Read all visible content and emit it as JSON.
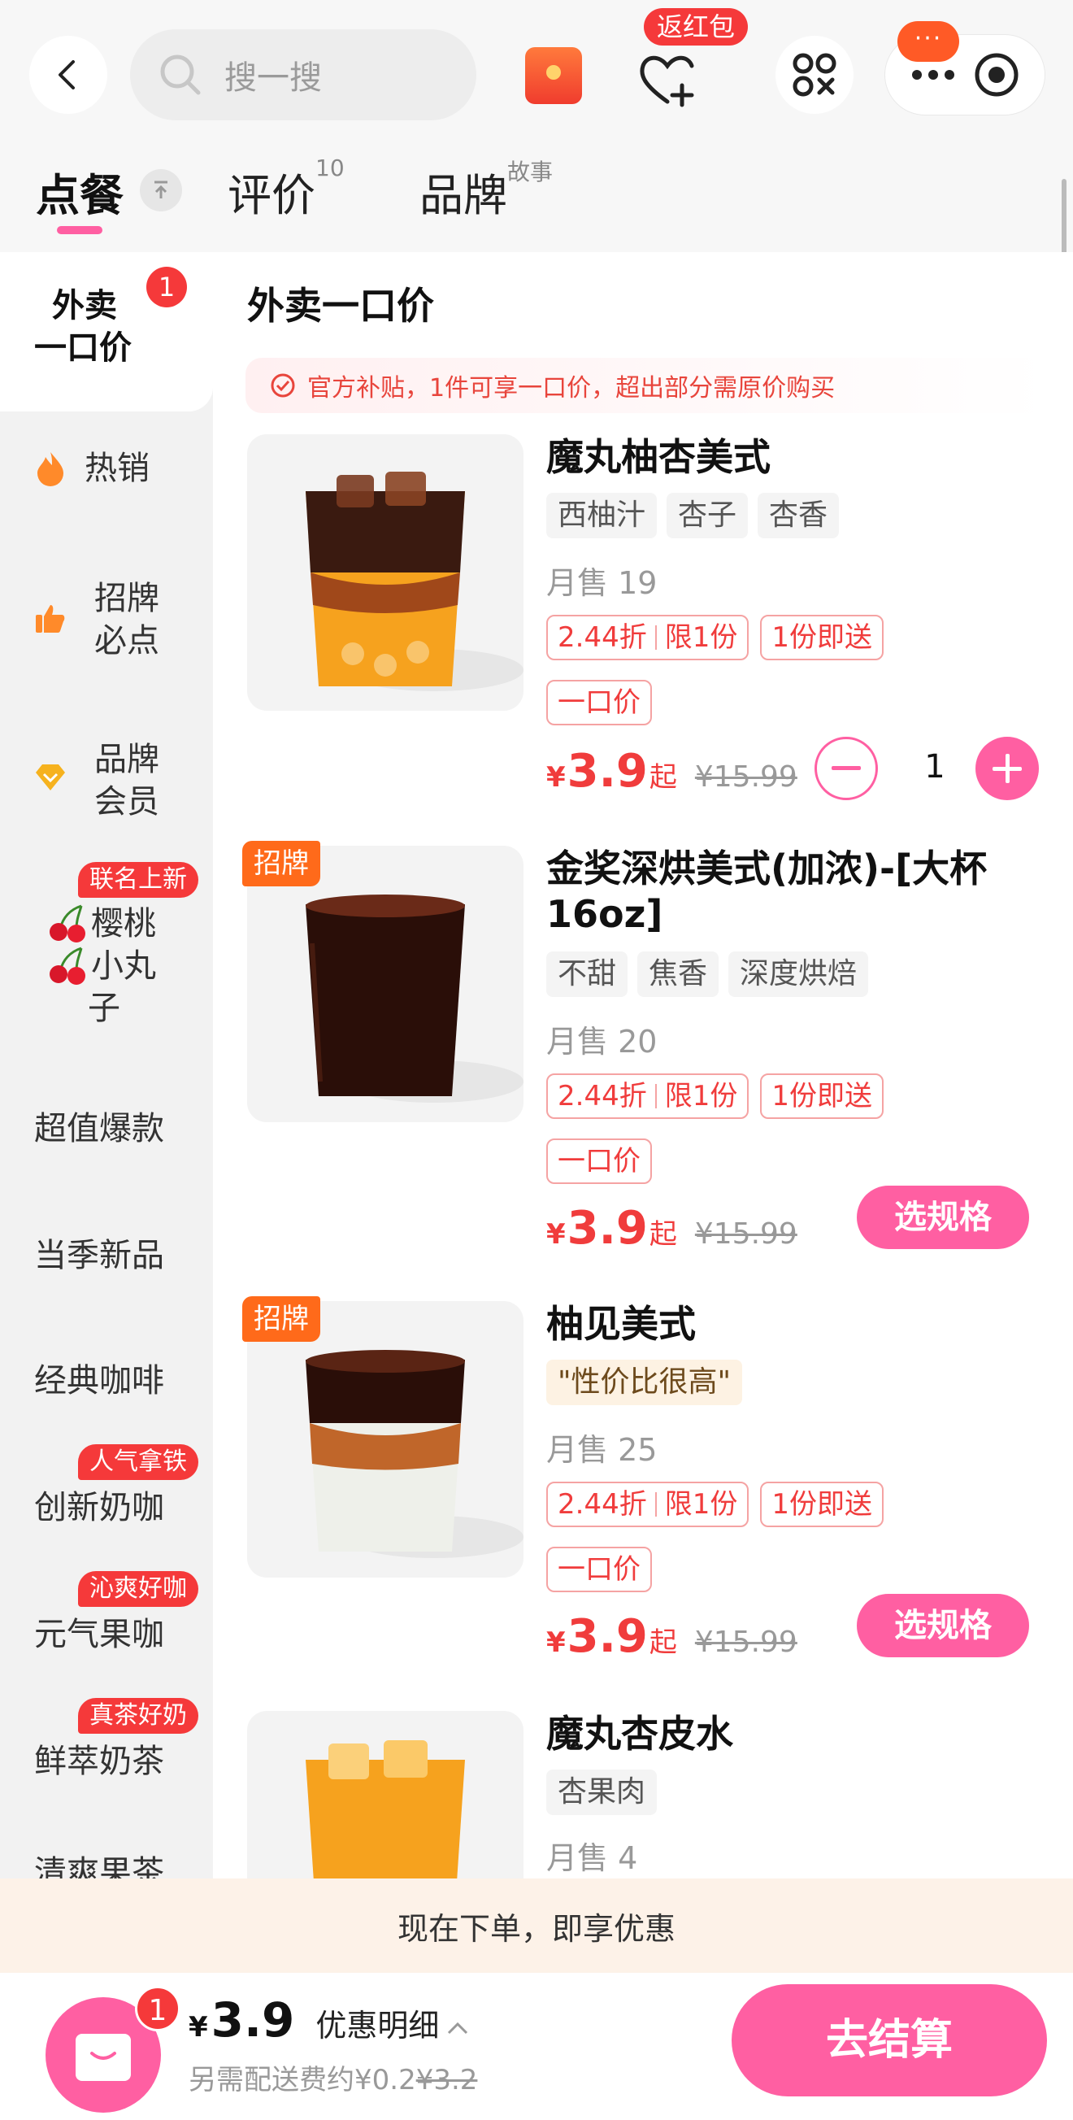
{
  "header": {
    "search_placeholder": "搜一搜",
    "fanhongbao_badge": "返红包",
    "more_badge": "···"
  },
  "tabs": [
    {
      "label": "点餐",
      "sup": ""
    },
    {
      "label": "评价",
      "sup": "10"
    },
    {
      "label": "品牌",
      "sup": "故事"
    }
  ],
  "sidebar": {
    "active": {
      "label_line1": "外卖",
      "label_line2": "一口价",
      "badge": "1"
    },
    "items": [
      {
        "label": "热销",
        "icon": "fire-icon"
      },
      {
        "label_line1": "招牌",
        "label_line2": "必点",
        "icon": "thumbs-up-icon"
      },
      {
        "label_line1": "品牌",
        "label_line2": "会员",
        "icon": "diamond-icon"
      },
      {
        "label_line1": "樱桃",
        "label_line2": "小丸",
        "label_line3": "子",
        "badge": "联名上新",
        "icon": "cherry-icon"
      },
      {
        "label": "超值爆款"
      },
      {
        "label": "当季新品"
      },
      {
        "label": "经典咖啡"
      },
      {
        "label": "创新奶咖",
        "badge": "人气拿铁"
      },
      {
        "label": "元气果咖",
        "badge": "沁爽好咖"
      },
      {
        "label": "鲜萃奶茶",
        "badge": "真茶好奶"
      },
      {
        "label": "清爽果茶"
      }
    ]
  },
  "section": {
    "title": "外卖一口价",
    "notice": "官方补贴，1件可享一口价，超出部分需原价购买"
  },
  "products": [
    {
      "name": "魔丸柚杏美式",
      "tags": [
        "西柚汁",
        "杏子",
        "杏香"
      ],
      "sold": "月售 19",
      "discount": "2.44折",
      "limit": "限1份",
      "deliver": "1份即送",
      "tag2": "一口价",
      "currency": "¥",
      "price": "3.9",
      "qi": "起",
      "orig": "¥15.99",
      "qty": "1",
      "badge": ""
    },
    {
      "name": "金奖深烘美式(加浓)-[大杯16oz]",
      "tags": [
        "不甜",
        "焦香",
        "深度烘焙"
      ],
      "sold": "月售 20",
      "discount": "2.44折",
      "limit": "限1份",
      "deliver": "1份即送",
      "tag2": "一口价",
      "currency": "¥",
      "price": "3.9",
      "qi": "起",
      "orig": "¥15.99",
      "button": "选规格",
      "badge": "招牌"
    },
    {
      "name": "柚见美式",
      "quote": "\"性价比很高\"",
      "sold": "月售 25",
      "discount": "2.44折",
      "limit": "限1份",
      "deliver": "1份即送",
      "tag2": "一口价",
      "currency": "¥",
      "price": "3.9",
      "qi": "起",
      "orig": "¥15.99",
      "button": "选规格",
      "badge": "招牌"
    },
    {
      "name": "魔丸杏皮水",
      "tags": [
        "杏果肉"
      ],
      "sold": "月售 4"
    }
  ],
  "bottom": {
    "promo_text": "现在下单，即享优惠",
    "cart_count": "1",
    "currency": "¥",
    "total": "3.9",
    "detail_label": "优惠明细",
    "fee_label": "另需配送费约¥0.2",
    "fee_orig": "¥3.2",
    "checkout_label": "去结算"
  },
  "colors": {
    "accent": "#ff5fa2",
    "red": "#f03c3c",
    "orange": "#ff6a1a"
  }
}
